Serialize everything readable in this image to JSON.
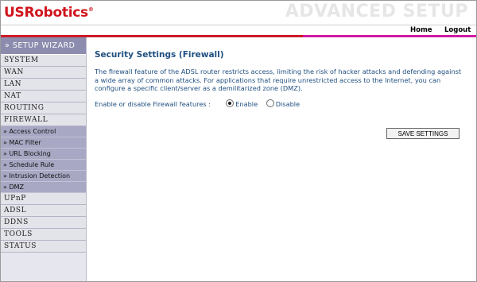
{
  "header": {
    "logo": "USRobotics",
    "logo_mark": "®",
    "banner": "ADVANCED SETUP",
    "links": {
      "home": "Home",
      "logout": "Logout"
    }
  },
  "sidebar": {
    "wizard": "» SETUP WIZARD",
    "items_top": [
      "SYSTEM",
      "WAN",
      "LAN",
      "NAT",
      "ROUTING",
      "FIREWALL"
    ],
    "sub_items": [
      "» Access Control",
      "» MAC Filter",
      "» URL Blocking",
      "» Schedule Rule",
      "» Intrusion Detection",
      "» DMZ"
    ],
    "items_bottom": [
      "UPnP",
      "ADSL",
      "DDNS",
      "TOOLS",
      "STATUS"
    ]
  },
  "main": {
    "title": "Security Settings (Firewall)",
    "description": "The firewall feature of the ADSL router restricts access, limiting the risk of hacker attacks and defending against a wide array of common attacks. For applications that require unrestricted access to the Internet, you can configure a specific client/server as a demilitarized zone (DMZ).",
    "firewall_label": "Enable or disable Firewall features :",
    "options": [
      "Enable",
      "Disable"
    ],
    "selected": "Enable",
    "save_label": "SAVE SETTINGS"
  },
  "colors": {
    "brand_red": "#d0141c",
    "accent_magenta": "#d11aa4",
    "text_blue": "#1f4f80",
    "sidebar_header": "#8c8caf",
    "sidebar_sub": "#a8a8c4"
  }
}
